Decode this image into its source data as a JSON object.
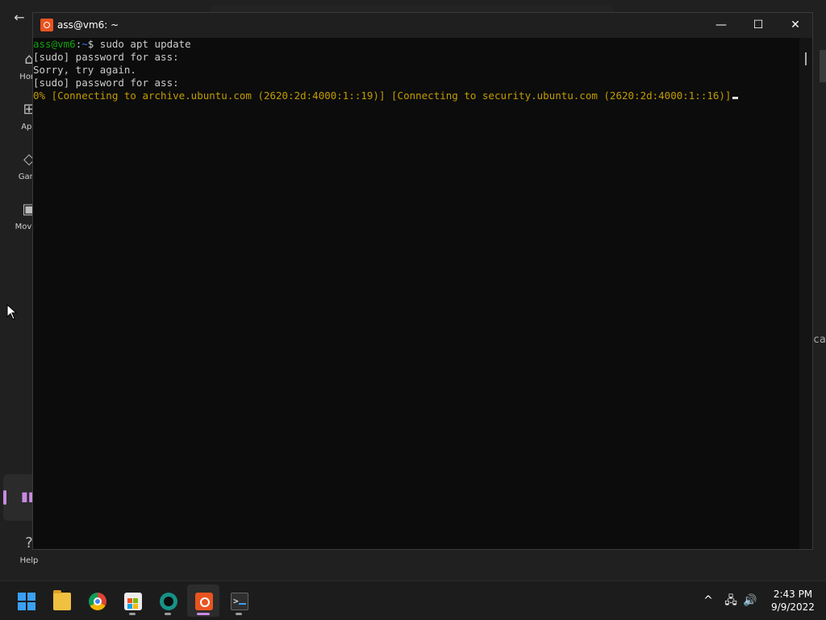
{
  "background_app": {
    "nav_items": [
      {
        "label": "Hom",
        "icon": "home-icon"
      },
      {
        "label": "App",
        "icon": "apps-icon"
      },
      {
        "label": "Gami",
        "icon": "gaming-icon"
      },
      {
        "label": "Movies",
        "icon": "movies-icon"
      }
    ],
    "help_label": "Help",
    "right_edge_text": "ca"
  },
  "terminal": {
    "title": "ass@vm6: ~",
    "prompt_user": "ass@vm6",
    "prompt_sep": ":",
    "prompt_path": "~",
    "prompt_symbol": "$",
    "command": " sudo apt update",
    "lines": [
      "[sudo] password for ass:",
      "Sorry, try again.",
      "[sudo] password for ass:"
    ],
    "status_line": "0% [Connecting to archive.ubuntu.com (2620:2d:4000:1::19)] [Connecting to security.ubuntu.com (2620:2d:4000:1::16)]",
    "controls": {
      "minimize": "—",
      "maximize": "☐",
      "close": "✕"
    }
  },
  "taskbar": {
    "apps": [
      "start",
      "file-explorer",
      "chrome",
      "microsoft-store",
      "gitkraken",
      "ubuntu",
      "windows-terminal"
    ],
    "tray": {
      "chevron": "^",
      "network": "🖧",
      "volume": "🔊"
    },
    "time": "2:43 PM",
    "date": "9/9/2022"
  },
  "colors": {
    "prompt_user": "#13a10e",
    "prompt_path": "#3b78ff",
    "status": "#c19c00",
    "terminal_bg": "#0c0c0c",
    "accent": "#c78be0"
  }
}
